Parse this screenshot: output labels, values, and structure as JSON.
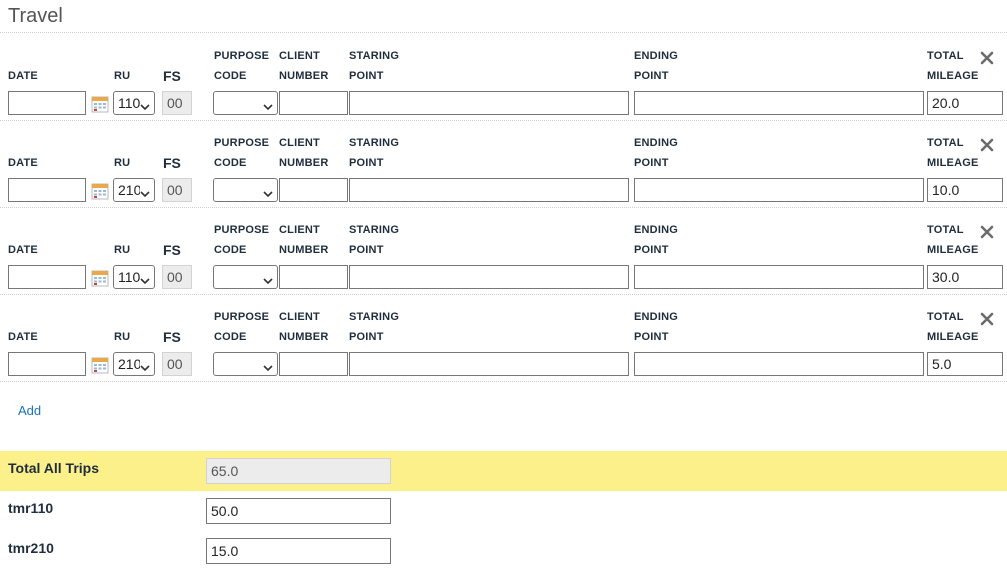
{
  "section": {
    "title": "Travel"
  },
  "labels": {
    "date": "DATE",
    "ru": "RU",
    "fs": "FS",
    "purpose_1": "PURPOSE",
    "purpose_2": "CODE",
    "client_1": "CLIENT",
    "client_2": "NUMBER",
    "start_1": "STARING",
    "start_2": "POINT",
    "end_1": "ENDING",
    "end_2": "POINT",
    "total_1": "TOTAL",
    "total_2": "MILEAGE"
  },
  "trips": [
    {
      "date": "",
      "ru": "110",
      "fs": "00",
      "purpose": "",
      "client": "",
      "start": "",
      "end": "",
      "mileage": "20.0"
    },
    {
      "date": "",
      "ru": "210",
      "fs": "00",
      "purpose": "",
      "client": "",
      "start": "",
      "end": "",
      "mileage": "10.0"
    },
    {
      "date": "",
      "ru": "110",
      "fs": "00",
      "purpose": "",
      "client": "",
      "start": "",
      "end": "",
      "mileage": "30.0"
    },
    {
      "date": "",
      "ru": "210",
      "fs": "00",
      "purpose": "",
      "client": "",
      "start": "",
      "end": "",
      "mileage": "5.0"
    }
  ],
  "add_label": "Add",
  "summary": {
    "total_label": "Total All Trips",
    "total_value": "65.0",
    "tmr110_label": "tmr110",
    "tmr110_value": "50.0",
    "tmr210_label": "tmr210",
    "tmr210_value": "15.0"
  },
  "icons": {
    "calendar": "calendar-icon",
    "close": "close-icon",
    "dropdown": "chevron-down-icon"
  },
  "colors": {
    "highlight": "#fbf08a",
    "link": "#1a73b8",
    "readonly_bg": "#ececec"
  }
}
